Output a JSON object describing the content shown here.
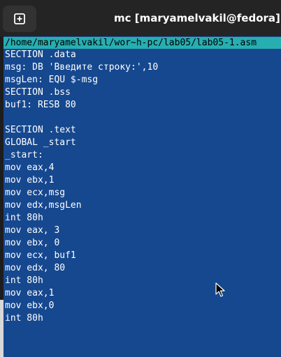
{
  "window": {
    "title": "mc [maryamelvakil@fedora]:~/work"
  },
  "titlebar": {
    "new_tab_icon": "new-tab-plus-icon"
  },
  "editor": {
    "path": "/home/maryamelvakil/wor~h-pc/lab05/lab05-1.asm",
    "lines": [
      "SECTION .data",
      "msg: DB 'Введите строку:',10",
      "msgLen: EQU $-msg",
      "SECTION .bss",
      "buf1: RESB 80",
      "",
      "SECTION .text",
      "GLOBAL _start",
      "_start:",
      "mov eax,4",
      "mov ebx,1",
      "mov ecx,msg",
      "mov edx,msgLen",
      "int 80h",
      "mov eax, 3",
      "mov ebx, 0",
      "mov ecx, buf1",
      "mov edx, 80",
      "int 80h",
      "mov eax,1",
      "mov ebx,0",
      "int 80h"
    ]
  },
  "colors": {
    "editor_bg": "#16488f",
    "path_bar_bg": "#27aeb1",
    "titlebar_bg": "#242424",
    "text": "#ffffff"
  },
  "pointer": {
    "icon": "mouse-pointer-icon"
  }
}
